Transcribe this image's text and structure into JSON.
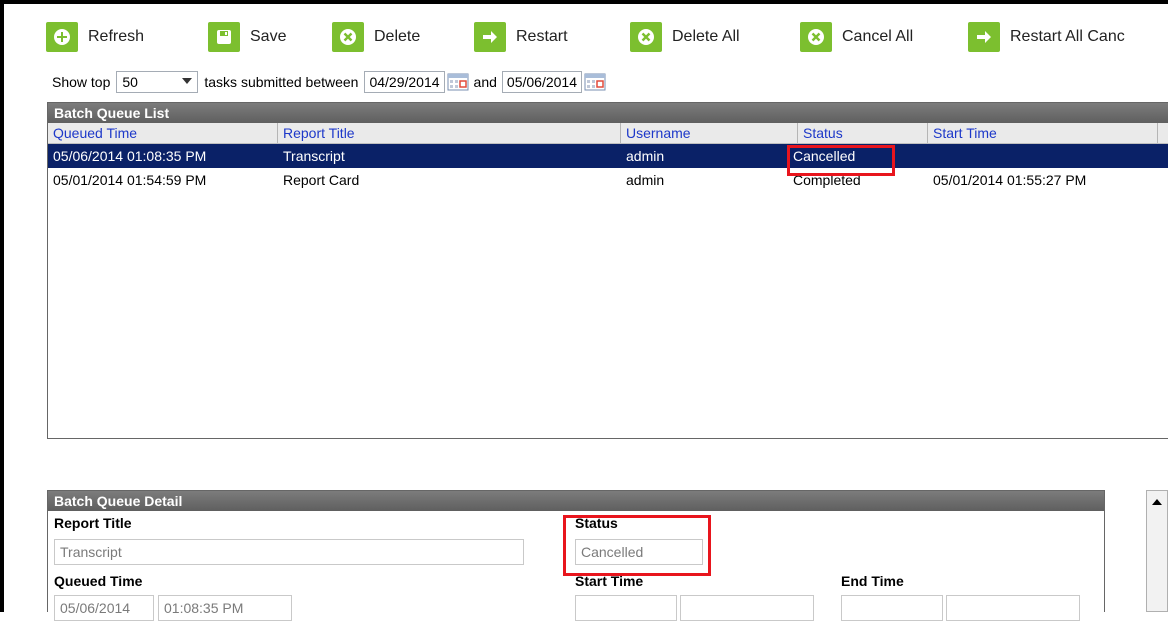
{
  "toolbar": {
    "refresh": "Refresh",
    "save": "Save",
    "delete": "Delete",
    "restart": "Restart",
    "delete_all": "Delete All",
    "cancel_all": "Cancel All",
    "restart_all": "Restart All Canc"
  },
  "filter": {
    "show_top_label": "Show top",
    "show_top_value": "50",
    "between_label": "tasks submitted between",
    "start_date": "04/29/2014",
    "and_label": "and",
    "end_date": "05/06/2014"
  },
  "list": {
    "title": "Batch Queue List",
    "columns": [
      "Queued Time",
      "Report Title",
      "Username",
      "Status",
      "Start Time"
    ],
    "rows": [
      {
        "queued": "05/06/2014 01:08:35 PM",
        "title": "Transcript",
        "user": "admin",
        "status": "Cancelled",
        "start": ""
      },
      {
        "queued": "05/01/2014 01:54:59 PM",
        "title": "Report Card",
        "user": "admin",
        "status": "Completed",
        "start": "05/01/2014 01:55:27 PM"
      }
    ]
  },
  "detail": {
    "title": "Batch Queue Detail",
    "report_title_label": "Report Title",
    "report_title_value": "Transcript",
    "status_label": "Status",
    "status_value": "Cancelled",
    "queued_time_label": "Queued Time",
    "queued_time_date": "05/06/2014",
    "queued_time_time": "01:08:35 PM",
    "start_time_label": "Start Time",
    "end_time_label": "End Time"
  },
  "colors": {
    "toolbar_icon": "#7cbf2f",
    "selected_row": "#0a2167",
    "header_link": "#1d38c9",
    "highlight": "#e8151d"
  }
}
